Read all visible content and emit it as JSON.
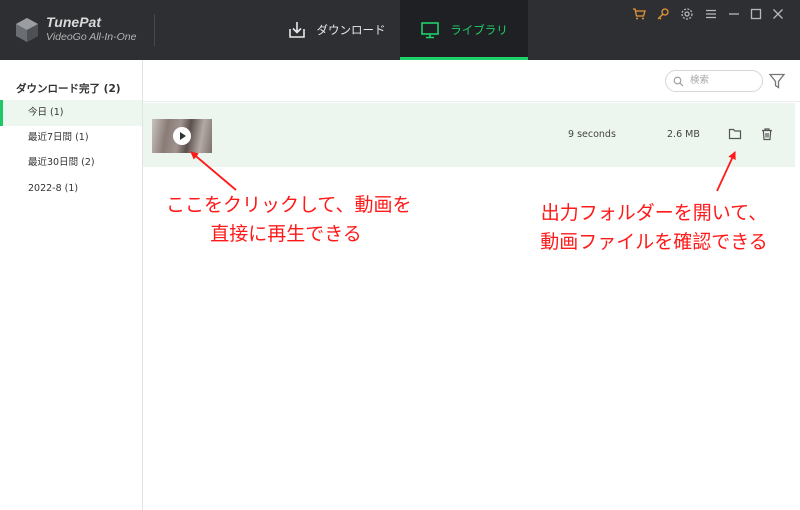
{
  "app": {
    "name": "TunePat",
    "subtitle": "VideoGo All-In-One"
  },
  "tabs": [
    {
      "label": "ダウンロード",
      "icon": "download-icon"
    },
    {
      "label": "ライブラリ",
      "icon": "monitor-icon",
      "active": true
    }
  ],
  "window_icons": [
    "cart-icon",
    "key-icon",
    "gear-icon",
    "menu-icon",
    "minimize-icon",
    "maximize-icon",
    "close-icon"
  ],
  "sidebar": {
    "heading": "ダウンロード完了 (2)",
    "items": [
      {
        "label": "今日 (1)",
        "active": true
      },
      {
        "label": "最近7日間 (1)"
      },
      {
        "label": "最近30日間 (2)"
      },
      {
        "label": "2022-8 (1)"
      }
    ]
  },
  "search": {
    "placeholder": "検索",
    "value": ""
  },
  "row": {
    "duration": "9 seconds",
    "size": "2.6 MB"
  },
  "annotations": {
    "play": "ここをクリックして、動画を\n直接に再生できる",
    "folder": "出力フォルダーを開いて、\n動画ファイルを確認できる"
  },
  "colors": {
    "accent": "#1fd16a",
    "topbar": "#2d2f33",
    "annotation": "#ff1a1a",
    "row_bg": "#edf5ef"
  }
}
